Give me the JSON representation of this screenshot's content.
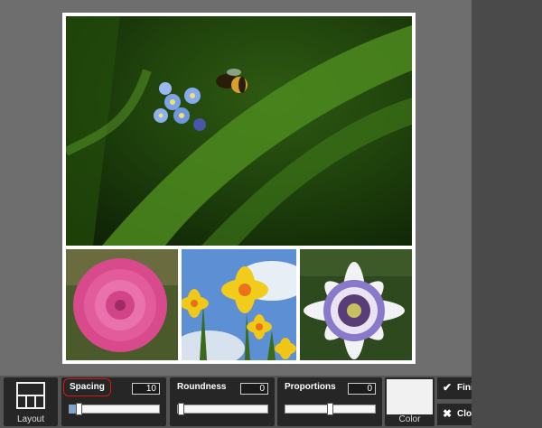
{
  "toolbar": {
    "layout_label": "Layout",
    "spacing": {
      "label": "Spacing",
      "value": "10",
      "level": 0.08
    },
    "roundness": {
      "label": "Roundness",
      "value": "0",
      "level": 0.0
    },
    "proportions": {
      "label": "Proportions",
      "value": "0",
      "level": 0.5
    },
    "color_label": "Color",
    "finish_label": "Finish",
    "close_label": "Close",
    "finish_icon": "checkmark-icon",
    "close_icon": "x-icon",
    "swatch_color": "#f1f1f1"
  },
  "colors": {
    "workspace": "#6e6e6e",
    "tool_bg": "#262626",
    "slider_fill": "#7aa7d8",
    "highlight": "#d81818"
  },
  "photos": [
    {
      "subject": "blue forget-me-not flowers and a bumblebee over green grass"
    },
    {
      "subject": "pink dahlia"
    },
    {
      "subject": "yellow daffodils against blue sky"
    },
    {
      "subject": "passion flower"
    }
  ]
}
